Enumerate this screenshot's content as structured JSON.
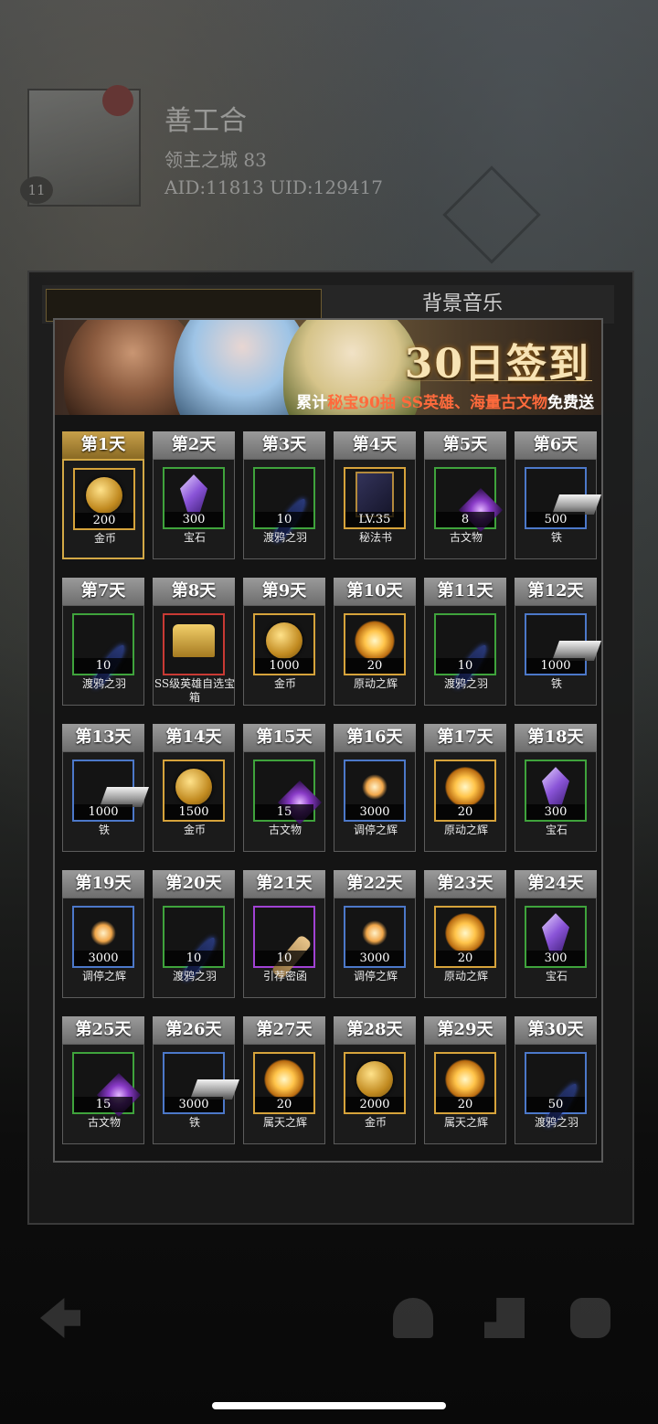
{
  "profile": {
    "name": "善工合",
    "subtitle": "领主之城 83",
    "ids": "AID:11813 UID:129417"
  },
  "tabs": {
    "background_music": "背景音乐"
  },
  "banner": {
    "title": "30日签到",
    "sub_prefix": "累计",
    "sub_highlight": "秘宝90抽 SS英雄、海量古文物",
    "sub_suffix": "免费送"
  },
  "days": [
    {
      "day": "第1天",
      "qty": "200",
      "name": "金币",
      "icon": "coin",
      "rarity": "gold",
      "current": true
    },
    {
      "day": "第2天",
      "qty": "300",
      "name": "宝石",
      "icon": "gem",
      "rarity": "green"
    },
    {
      "day": "第3天",
      "qty": "10",
      "name": "渡鸦之羽",
      "icon": "feather",
      "rarity": "green"
    },
    {
      "day": "第4天",
      "qty": "LV.35",
      "name": "秘法书",
      "icon": "book",
      "rarity": "gold"
    },
    {
      "day": "第5天",
      "qty": "8",
      "name": "古文物",
      "icon": "relic",
      "rarity": "green"
    },
    {
      "day": "第6天",
      "qty": "500",
      "name": "铁",
      "icon": "iron",
      "rarity": "blue"
    },
    {
      "day": "第7天",
      "qty": "10",
      "name": "渡鸦之羽",
      "icon": "feather",
      "rarity": "green"
    },
    {
      "day": "第8天",
      "qty": "",
      "name": "SS级英雄自选宝箱",
      "icon": "chest",
      "rarity": "red"
    },
    {
      "day": "第9天",
      "qty": "1000",
      "name": "金币",
      "icon": "coin",
      "rarity": "gold"
    },
    {
      "day": "第10天",
      "qty": "20",
      "name": "原动之辉",
      "icon": "sun",
      "rarity": "gold"
    },
    {
      "day": "第11天",
      "qty": "10",
      "name": "渡鸦之羽",
      "icon": "feather",
      "rarity": "green"
    },
    {
      "day": "第12天",
      "qty": "1000",
      "name": "铁",
      "icon": "iron",
      "rarity": "blue"
    },
    {
      "day": "第13天",
      "qty": "1000",
      "name": "铁",
      "icon": "iron",
      "rarity": "blue"
    },
    {
      "day": "第14天",
      "qty": "1500",
      "name": "金币",
      "icon": "coin",
      "rarity": "gold"
    },
    {
      "day": "第15天",
      "qty": "15",
      "name": "古文物",
      "icon": "relic",
      "rarity": "green"
    },
    {
      "day": "第16天",
      "qty": "3000",
      "name": "调停之辉",
      "icon": "star",
      "rarity": "blue"
    },
    {
      "day": "第17天",
      "qty": "20",
      "name": "原动之辉",
      "icon": "sun",
      "rarity": "gold"
    },
    {
      "day": "第18天",
      "qty": "300",
      "name": "宝石",
      "icon": "gem",
      "rarity": "green"
    },
    {
      "day": "第19天",
      "qty": "3000",
      "name": "调停之辉",
      "icon": "star",
      "rarity": "blue"
    },
    {
      "day": "第20天",
      "qty": "10",
      "name": "渡鸦之羽",
      "icon": "feather",
      "rarity": "green"
    },
    {
      "day": "第21天",
      "qty": "10",
      "name": "引荐密函",
      "icon": "scroll",
      "rarity": "purple"
    },
    {
      "day": "第22天",
      "qty": "3000",
      "name": "调停之辉",
      "icon": "star",
      "rarity": "blue"
    },
    {
      "day": "第23天",
      "qty": "20",
      "name": "原动之辉",
      "icon": "sun",
      "rarity": "gold"
    },
    {
      "day": "第24天",
      "qty": "300",
      "name": "宝石",
      "icon": "gem",
      "rarity": "green"
    },
    {
      "day": "第25天",
      "qty": "15",
      "name": "古文物",
      "icon": "relic",
      "rarity": "green"
    },
    {
      "day": "第26天",
      "qty": "3000",
      "name": "铁",
      "icon": "iron",
      "rarity": "blue"
    },
    {
      "day": "第27天",
      "qty": "20",
      "name": "属天之辉",
      "icon": "sun",
      "rarity": "gold"
    },
    {
      "day": "第28天",
      "qty": "2000",
      "name": "金币",
      "icon": "coin",
      "rarity": "gold"
    },
    {
      "day": "第29天",
      "qty": "20",
      "name": "属天之辉",
      "icon": "sun",
      "rarity": "gold"
    },
    {
      "day": "第30天",
      "qty": "50",
      "name": "渡鸦之羽",
      "icon": "feather",
      "rarity": "blue"
    }
  ]
}
